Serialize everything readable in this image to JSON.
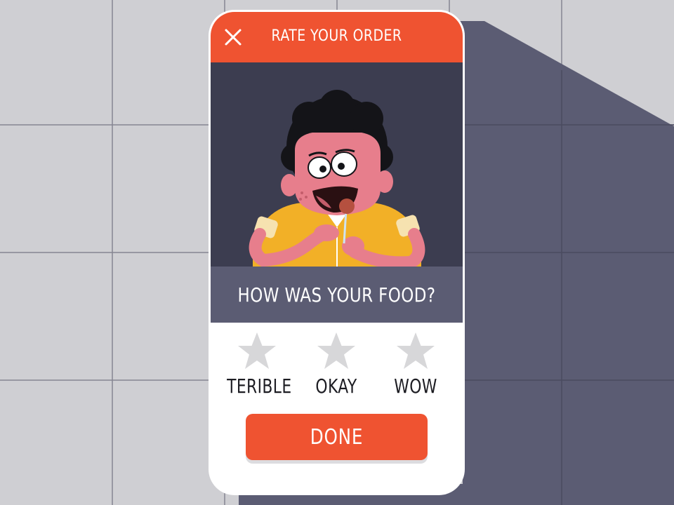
{
  "header": {
    "title": "RATE YOUR ORDER",
    "close_icon": "close-icon"
  },
  "illustration": {
    "subject": "character-eating-icon"
  },
  "question": {
    "text": "HOW WAS YOUR FOOD?"
  },
  "ratings": [
    {
      "label": "TERIBLE",
      "icon": "star-icon"
    },
    {
      "label": "OKAY",
      "icon": "star-icon"
    },
    {
      "label": "WOW",
      "icon": "star-icon"
    }
  ],
  "done_button": {
    "label": "DONE"
  },
  "colors": {
    "accent": "#ef5331",
    "illustration_bg": "#3c3d50",
    "question_band": "#5b5c73",
    "star": "#d7d7d9",
    "page_bg": "#cfcfd3",
    "shadow": "#5b5c73"
  }
}
